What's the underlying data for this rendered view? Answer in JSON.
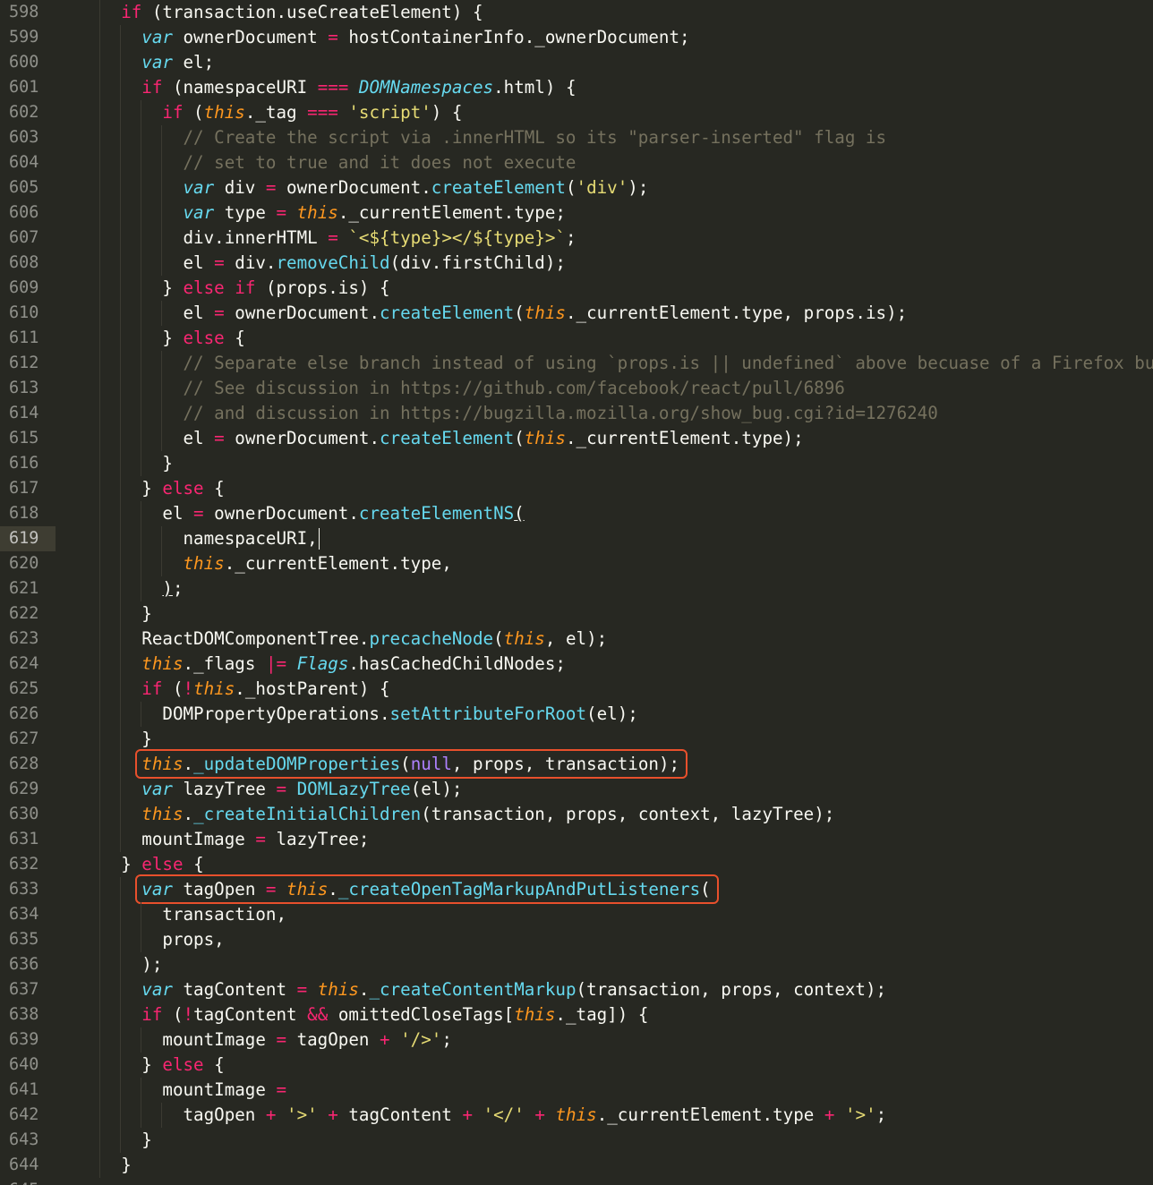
{
  "editor": {
    "theme_colors": {
      "background": "#272822",
      "keyword": "#f92672",
      "storage": "#66d9ef",
      "this": "#fd971f",
      "function": "#66d9ef",
      "string": "#e6db74",
      "comment": "#75715e",
      "number": "#ae81ff",
      "text": "#f8f8f2",
      "highlight_box": "#e8502c"
    },
    "active_line": "619",
    "highlight_boxes_on_lines": [
      "628",
      "633"
    ],
    "lines": [
      {
        "n": "598",
        "indent": 2,
        "tokens": [
          [
            "kw",
            "if"
          ],
          [
            "pl",
            " (transaction.useCreateElement) {"
          ]
        ]
      },
      {
        "n": "599",
        "indent": 3,
        "tokens": [
          [
            "st",
            "var"
          ],
          [
            "pl",
            " ownerDocument "
          ],
          [
            "op",
            "="
          ],
          [
            "pl",
            " hostContainerInfo._ownerDocument;"
          ]
        ]
      },
      {
        "n": "600",
        "indent": 3,
        "tokens": [
          [
            "st",
            "var"
          ],
          [
            "pl",
            " el;"
          ]
        ]
      },
      {
        "n": "601",
        "indent": 3,
        "tokens": [
          [
            "kw",
            "if"
          ],
          [
            "pl",
            " (namespaceURI "
          ],
          [
            "op",
            "==="
          ],
          [
            "pl",
            " "
          ],
          [
            "st",
            "DOMNamespaces"
          ],
          [
            "pl",
            ".html) {"
          ]
        ]
      },
      {
        "n": "602",
        "indent": 4,
        "tokens": [
          [
            "kw",
            "if"
          ],
          [
            "pl",
            " ("
          ],
          [
            "th",
            "this"
          ],
          [
            "pl",
            "._tag "
          ],
          [
            "op",
            "==="
          ],
          [
            "pl",
            " "
          ],
          [
            "sl",
            "'script'"
          ],
          [
            "pl",
            ") {"
          ]
        ]
      },
      {
        "n": "603",
        "indent": 5,
        "tokens": [
          [
            "cm",
            "// Create the script via .innerHTML so its \"parser-inserted\" flag is"
          ]
        ]
      },
      {
        "n": "604",
        "indent": 5,
        "tokens": [
          [
            "cm",
            "// set to true and it does not execute"
          ]
        ]
      },
      {
        "n": "605",
        "indent": 5,
        "tokens": [
          [
            "st",
            "var"
          ],
          [
            "pl",
            " div "
          ],
          [
            "op",
            "="
          ],
          [
            "pl",
            " ownerDocument."
          ],
          [
            "fn",
            "createElement"
          ],
          [
            "pl",
            "("
          ],
          [
            "sl",
            "'div'"
          ],
          [
            "pl",
            ");"
          ]
        ]
      },
      {
        "n": "606",
        "indent": 5,
        "tokens": [
          [
            "st",
            "var"
          ],
          [
            "pl",
            " type "
          ],
          [
            "op",
            "="
          ],
          [
            "pl",
            " "
          ],
          [
            "th",
            "this"
          ],
          [
            "pl",
            "._currentElement.type;"
          ]
        ]
      },
      {
        "n": "607",
        "indent": 5,
        "tokens": [
          [
            "pl",
            "div.innerHTML "
          ],
          [
            "op",
            "="
          ],
          [
            "pl",
            " "
          ],
          [
            "sl",
            "`<${type}></${type}>`"
          ],
          [
            "pl",
            ";"
          ]
        ]
      },
      {
        "n": "608",
        "indent": 5,
        "tokens": [
          [
            "pl",
            "el "
          ],
          [
            "op",
            "="
          ],
          [
            "pl",
            " div."
          ],
          [
            "fn",
            "removeChild"
          ],
          [
            "pl",
            "(div.firstChild);"
          ]
        ]
      },
      {
        "n": "609",
        "indent": 4,
        "tokens": [
          [
            "pl",
            "} "
          ],
          [
            "kw",
            "else"
          ],
          [
            "pl",
            " "
          ],
          [
            "kw",
            "if"
          ],
          [
            "pl",
            " (props.is) {"
          ]
        ]
      },
      {
        "n": "610",
        "indent": 5,
        "tokens": [
          [
            "pl",
            "el "
          ],
          [
            "op",
            "="
          ],
          [
            "pl",
            " ownerDocument."
          ],
          [
            "fn",
            "createElement"
          ],
          [
            "pl",
            "("
          ],
          [
            "th",
            "this"
          ],
          [
            "pl",
            "._currentElement.type, props.is);"
          ]
        ]
      },
      {
        "n": "611",
        "indent": 4,
        "tokens": [
          [
            "pl",
            "} "
          ],
          [
            "kw",
            "else"
          ],
          [
            "pl",
            " {"
          ]
        ]
      },
      {
        "n": "612",
        "indent": 5,
        "tokens": [
          [
            "cm",
            "// Separate else branch instead of using `props.is || undefined` above becuase of a Firefox bug."
          ]
        ]
      },
      {
        "n": "613",
        "indent": 5,
        "tokens": [
          [
            "cm",
            "// See discussion in https://github.com/facebook/react/pull/6896"
          ]
        ]
      },
      {
        "n": "614",
        "indent": 5,
        "tokens": [
          [
            "cm",
            "// and discussion in https://bugzilla.mozilla.org/show_bug.cgi?id=1276240"
          ]
        ]
      },
      {
        "n": "615",
        "indent": 5,
        "tokens": [
          [
            "pl",
            "el "
          ],
          [
            "op",
            "="
          ],
          [
            "pl",
            " ownerDocument."
          ],
          [
            "fn",
            "createElement"
          ],
          [
            "pl",
            "("
          ],
          [
            "th",
            "this"
          ],
          [
            "pl",
            "._currentElement.type);"
          ]
        ]
      },
      {
        "n": "616",
        "indent": 4,
        "tokens": [
          [
            "pl",
            "}"
          ]
        ]
      },
      {
        "n": "617",
        "indent": 3,
        "tokens": [
          [
            "pl",
            "} "
          ],
          [
            "kw",
            "else"
          ],
          [
            "pl",
            " {"
          ]
        ]
      },
      {
        "n": "618",
        "indent": 4,
        "tokens": [
          [
            "pl",
            "el "
          ],
          [
            "op",
            "="
          ],
          [
            "pl",
            " ownerDocument."
          ],
          [
            "fn",
            "createElementNS"
          ],
          [
            "ul",
            "("
          ]
        ]
      },
      {
        "n": "619",
        "indent": 5,
        "tokens": [
          [
            "pl",
            "namespaceURI,"
          ]
        ],
        "cursor": true
      },
      {
        "n": "620",
        "indent": 5,
        "tokens": [
          [
            "th",
            "this"
          ],
          [
            "pl",
            "._currentElement.type,"
          ]
        ]
      },
      {
        "n": "621",
        "indent": 4,
        "tokens": [
          [
            "ul",
            ")"
          ],
          [
            "pl",
            ";"
          ]
        ]
      },
      {
        "n": "622",
        "indent": 3,
        "tokens": [
          [
            "pl",
            "}"
          ]
        ]
      },
      {
        "n": "623",
        "indent": 3,
        "tokens": [
          [
            "pl",
            "ReactDOMComponentTree."
          ],
          [
            "fn",
            "precacheNode"
          ],
          [
            "pl",
            "("
          ],
          [
            "th",
            "this"
          ],
          [
            "pl",
            ", el);"
          ]
        ]
      },
      {
        "n": "624",
        "indent": 3,
        "tokens": [
          [
            "th",
            "this"
          ],
          [
            "pl",
            "._flags "
          ],
          [
            "op",
            "|="
          ],
          [
            "pl",
            " "
          ],
          [
            "st",
            "Flags"
          ],
          [
            "pl",
            ".hasCachedChildNodes;"
          ]
        ]
      },
      {
        "n": "625",
        "indent": 3,
        "tokens": [
          [
            "kw",
            "if"
          ],
          [
            "pl",
            " ("
          ],
          [
            "op",
            "!"
          ],
          [
            "th",
            "this"
          ],
          [
            "pl",
            "._hostParent) {"
          ]
        ]
      },
      {
        "n": "626",
        "indent": 4,
        "tokens": [
          [
            "pl",
            "DOMPropertyOperations."
          ],
          [
            "fn",
            "setAttributeForRoot"
          ],
          [
            "pl",
            "(el);"
          ]
        ]
      },
      {
        "n": "627",
        "indent": 3,
        "tokens": [
          [
            "pl",
            "}"
          ]
        ]
      },
      {
        "n": "628",
        "indent": 3,
        "tokens": [
          [
            "th",
            "this"
          ],
          [
            "pl",
            "."
          ],
          [
            "fn",
            "_updateDOMProperties"
          ],
          [
            "pl",
            "("
          ],
          [
            "nu",
            "null"
          ],
          [
            "pl",
            ", props, transaction);"
          ]
        ]
      },
      {
        "n": "629",
        "indent": 3,
        "tokens": [
          [
            "st",
            "var"
          ],
          [
            "pl",
            " lazyTree "
          ],
          [
            "op",
            "="
          ],
          [
            "pl",
            " "
          ],
          [
            "fn",
            "DOMLazyTree"
          ],
          [
            "pl",
            "(el);"
          ]
        ]
      },
      {
        "n": "630",
        "indent": 3,
        "tokens": [
          [
            "th",
            "this"
          ],
          [
            "pl",
            "."
          ],
          [
            "fn",
            "_createInitialChildren"
          ],
          [
            "pl",
            "(transaction, props, context, lazyTree);"
          ]
        ]
      },
      {
        "n": "631",
        "indent": 3,
        "tokens": [
          [
            "pl",
            "mountImage "
          ],
          [
            "op",
            "="
          ],
          [
            "pl",
            " lazyTree;"
          ]
        ]
      },
      {
        "n": "632",
        "indent": 2,
        "tokens": [
          [
            "pl",
            "} "
          ],
          [
            "kw",
            "else"
          ],
          [
            "pl",
            " {"
          ]
        ]
      },
      {
        "n": "633",
        "indent": 3,
        "tokens": [
          [
            "st",
            "var"
          ],
          [
            "pl",
            " tagOpen "
          ],
          [
            "op",
            "="
          ],
          [
            "pl",
            " "
          ],
          [
            "th",
            "this"
          ],
          [
            "pl",
            "."
          ],
          [
            "fn",
            "_createOpenTagMarkupAndPutListeners"
          ],
          [
            "pl",
            "("
          ]
        ]
      },
      {
        "n": "634",
        "indent": 4,
        "tokens": [
          [
            "pl",
            "transaction,"
          ]
        ]
      },
      {
        "n": "635",
        "indent": 4,
        "tokens": [
          [
            "pl",
            "props,"
          ]
        ]
      },
      {
        "n": "636",
        "indent": 3,
        "tokens": [
          [
            "pl",
            ");"
          ]
        ]
      },
      {
        "n": "637",
        "indent": 3,
        "tokens": [
          [
            "st",
            "var"
          ],
          [
            "pl",
            " tagContent "
          ],
          [
            "op",
            "="
          ],
          [
            "pl",
            " "
          ],
          [
            "th",
            "this"
          ],
          [
            "pl",
            "."
          ],
          [
            "fn",
            "_createContentMarkup"
          ],
          [
            "pl",
            "(transaction, props, context);"
          ]
        ]
      },
      {
        "n": "638",
        "indent": 3,
        "tokens": [
          [
            "kw",
            "if"
          ],
          [
            "pl",
            " ("
          ],
          [
            "op",
            "!"
          ],
          [
            "pl",
            "tagContent "
          ],
          [
            "op",
            "&&"
          ],
          [
            "pl",
            " omittedCloseTags["
          ],
          [
            "th",
            "this"
          ],
          [
            "pl",
            "._tag]) {"
          ]
        ]
      },
      {
        "n": "639",
        "indent": 4,
        "tokens": [
          [
            "pl",
            "mountImage "
          ],
          [
            "op",
            "="
          ],
          [
            "pl",
            " tagOpen "
          ],
          [
            "op",
            "+"
          ],
          [
            "pl",
            " "
          ],
          [
            "sl",
            "'/>'"
          ],
          [
            "pl",
            ";"
          ]
        ]
      },
      {
        "n": "640",
        "indent": 3,
        "tokens": [
          [
            "pl",
            "} "
          ],
          [
            "kw",
            "else"
          ],
          [
            "pl",
            " {"
          ]
        ]
      },
      {
        "n": "641",
        "indent": 4,
        "tokens": [
          [
            "pl",
            "mountImage "
          ],
          [
            "op",
            "="
          ]
        ]
      },
      {
        "n": "642",
        "indent": 5,
        "tokens": [
          [
            "pl",
            "tagOpen "
          ],
          [
            "op",
            "+"
          ],
          [
            "pl",
            " "
          ],
          [
            "sl",
            "'>'"
          ],
          [
            "pl",
            " "
          ],
          [
            "op",
            "+"
          ],
          [
            "pl",
            " tagContent "
          ],
          [
            "op",
            "+"
          ],
          [
            "pl",
            " "
          ],
          [
            "sl",
            "'</'"
          ],
          [
            "pl",
            " "
          ],
          [
            "op",
            "+"
          ],
          [
            "pl",
            " "
          ],
          [
            "th",
            "this"
          ],
          [
            "pl",
            "._currentElement.type "
          ],
          [
            "op",
            "+"
          ],
          [
            "pl",
            " "
          ],
          [
            "sl",
            "'>'"
          ],
          [
            "pl",
            ";"
          ]
        ]
      },
      {
        "n": "643",
        "indent": 3,
        "tokens": [
          [
            "pl",
            "}"
          ]
        ]
      },
      {
        "n": "644",
        "indent": 2,
        "tokens": [
          [
            "pl",
            "}"
          ]
        ]
      },
      {
        "n": "645",
        "indent": 0,
        "tokens": []
      }
    ]
  }
}
